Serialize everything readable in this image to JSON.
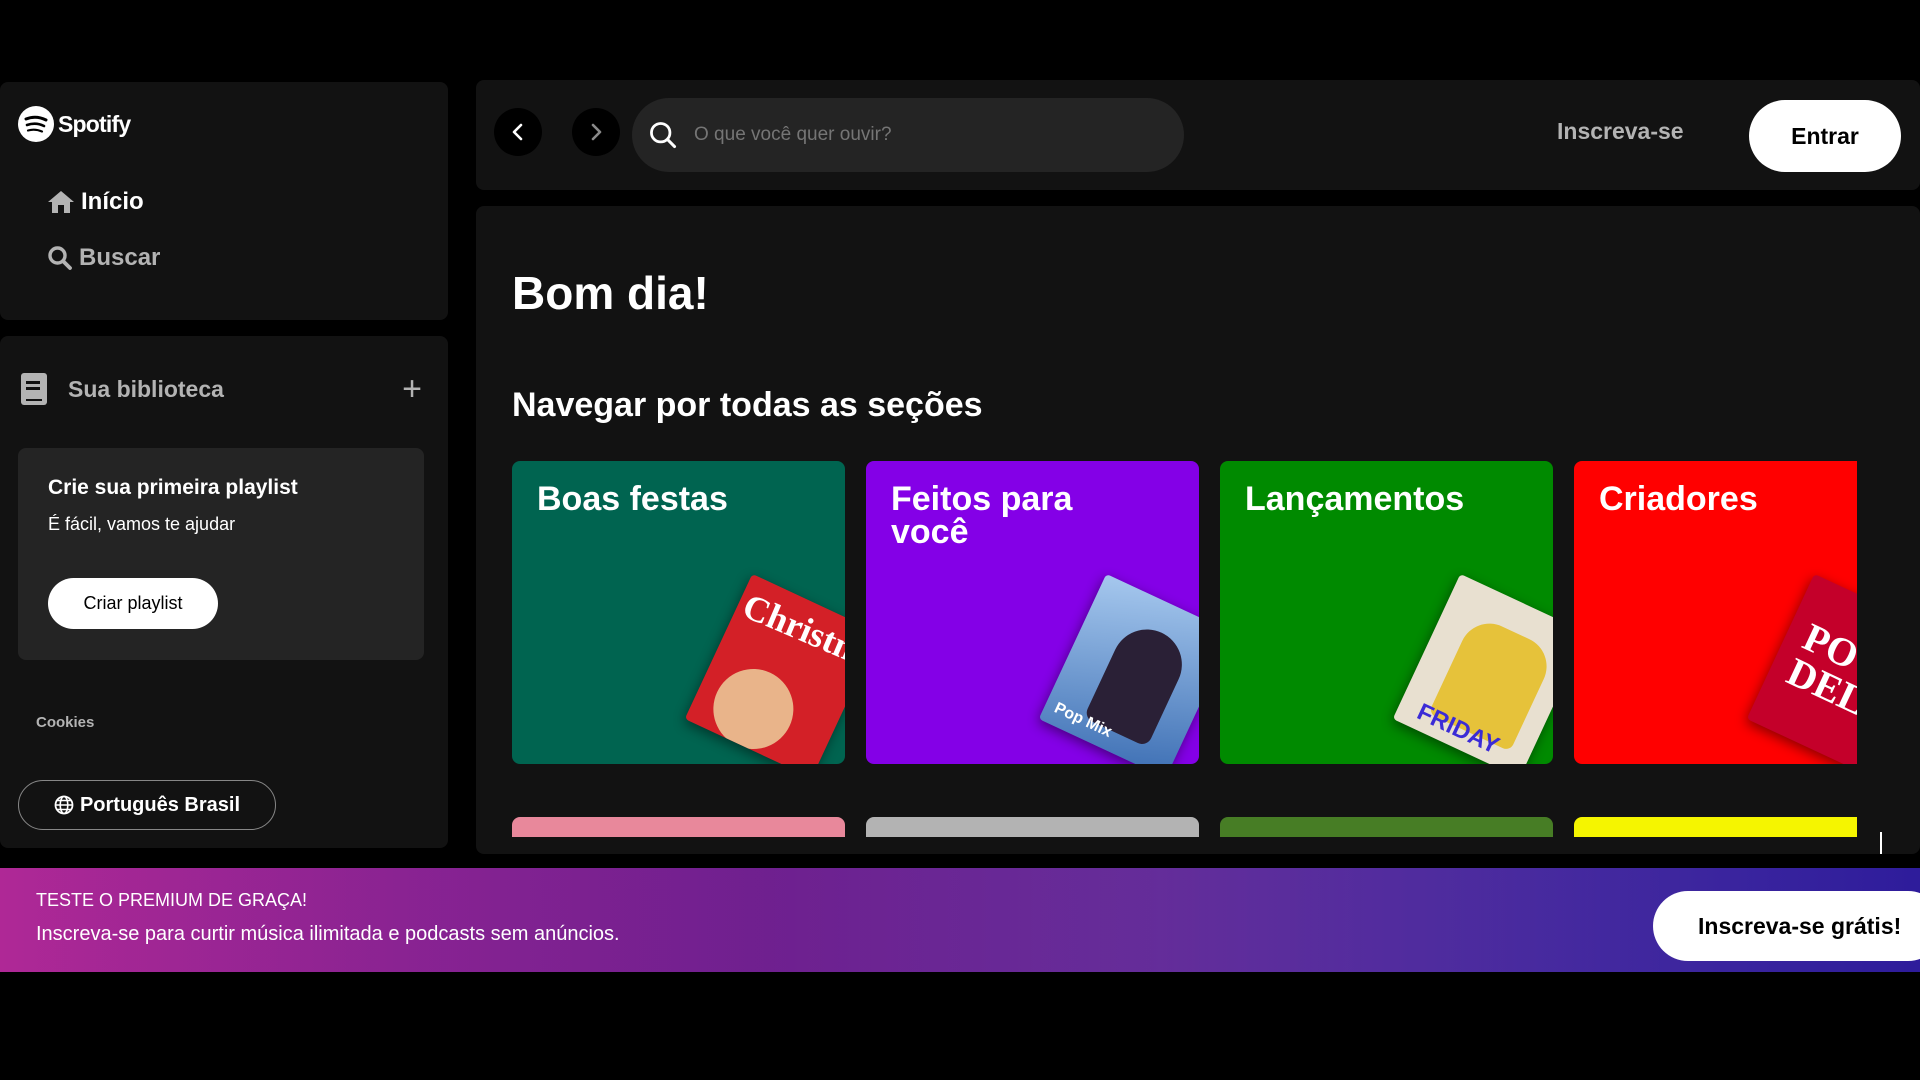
{
  "sidebar": {
    "brand": "Spotify",
    "nav": [
      {
        "label": "Início",
        "icon": "home-icon"
      },
      {
        "label": "Buscar",
        "icon": "search-icon"
      }
    ],
    "library": {
      "title": "Sua biblioteca",
      "add_icon": "plus-icon",
      "card": {
        "title": "Crie sua primeira playlist",
        "subtitle": "É fácil, vamos te ajudar",
        "button": "Criar playlist"
      },
      "cookies": "Cookies",
      "language": "Português Brasil"
    }
  },
  "topbar": {
    "back_icon": "chevron-left-icon",
    "forward_icon": "chevron-right-icon",
    "search_placeholder": "O que você quer ouvir?",
    "signup": "Inscreva-se",
    "login": "Entrar"
  },
  "main": {
    "greeting": "Bom dia!",
    "section_title": "Navegar por todas as seções",
    "cards": [
      {
        "title": "Boas festas",
        "color": "#006450",
        "art_color": "#d32027",
        "art_text": "Christm Hi"
      },
      {
        "title": "Feitos para você",
        "color": "#8400e7",
        "art_color": "#6fa0d6",
        "art_text": "Pop Mix"
      },
      {
        "title": "Lançamentos",
        "color": "#008a00",
        "art_color": "#e8e0d0",
        "art_text": "FRIDAY"
      },
      {
        "title": "Criadores",
        "color": "#ff0000",
        "art_color": "#c4002a",
        "art_text": "PO DELA"
      }
    ],
    "strip_colors": [
      "#e8889b",
      "#b3b3b3",
      "#477d25",
      "#f5f500"
    ]
  },
  "banner": {
    "headline": "TESTE O PREMIUM DE GRAÇA!",
    "text": "Inscreva-se para curtir música ilimitada e podcasts sem anúncios.",
    "button": "Inscreva-se grátis!"
  }
}
